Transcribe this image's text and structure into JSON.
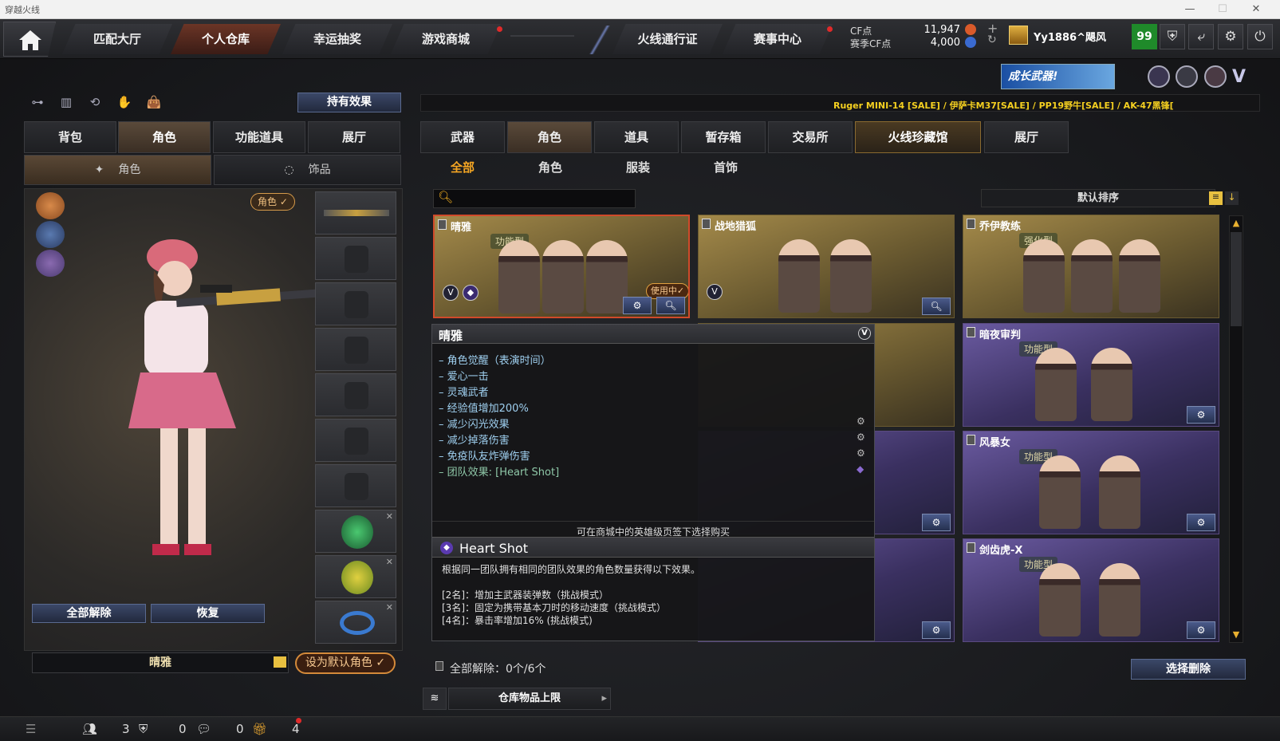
{
  "window": {
    "title": "穿越火线"
  },
  "topnav": {
    "tabs": [
      {
        "label": "匹配大厅"
      },
      {
        "label": "个人仓库",
        "active": true
      },
      {
        "label": "幸运抽奖"
      },
      {
        "label": "游戏商城"
      },
      {
        "label": "火线通行证"
      },
      {
        "label": "赛事中心"
      }
    ],
    "cf_label": "CF点",
    "season_cf_label": "赛季CF点",
    "cf_value": "11,947",
    "season_cf_value": "4,000",
    "username": "Yy1886^飓风",
    "level": "99"
  },
  "promo": {
    "label": "成长武器!"
  },
  "ticker": {
    "text": "Ruger MINI-14  [SALE] / 伊萨卡M37[SALE] / PP19野牛[SALE] / AK-47黑锋["
  },
  "left": {
    "hold_effect_button": "持有效果",
    "tabs": [
      "背包",
      "角色",
      "功能道具",
      "展厅"
    ],
    "subtabs": [
      "角色",
      "饰品"
    ],
    "role_badge": "角色",
    "unequip_all": "全部解除",
    "restore": "恢复",
    "character_name": "晴雅",
    "set_default": "设为默认角色"
  },
  "right": {
    "tabs": [
      "武器",
      "角色",
      "道具",
      "暂存箱",
      "交易所",
      "火线珍藏馆",
      "展厅"
    ],
    "subtabs": [
      "全部",
      "角色",
      "服装",
      "首饰"
    ],
    "search_placeholder": "",
    "sort_label": "默认排序",
    "cards": [
      {
        "name": "晴雅",
        "type": "功能型",
        "in_use": "使用中"
      },
      {
        "name": "战地猎狐",
        "type": ""
      },
      {
        "name": "乔伊教练",
        "type": "强化型"
      },
      {
        "name": "暗夜审判",
        "type": "功能型"
      },
      {
        "name": "风暴女",
        "type": "功能型"
      },
      {
        "name": "剑齿虎-X",
        "type": "功能型"
      }
    ],
    "unequip_count": "全部解除：0个/6个",
    "select_delete": "选择删除",
    "storage_limit": "仓库物品上限"
  },
  "tooltip": {
    "title": "晴雅",
    "lines": [
      "– 角色觉醒（表演时间）",
      "– 爱心一击",
      "– 灵魂武者",
      "– 经验值增加200%",
      "– 减少闪光效果",
      "– 减少掉落伤害",
      "– 免疫队友炸弹伤害",
      "– 团队效果: [Heart Shot]"
    ],
    "note": "可在商城中的英雄级页签下选择购买",
    "effect_title": "Heart Shot",
    "effect_desc": "根据同一团队拥有相同的团队效果的角色数量获得以下效果。",
    "effect_lines": [
      "[2名]：增加主武器装弹数（挑战模式）",
      "[3名]：固定为携带基本刀时的移动速度（挑战模式）",
      "[4名]：暴击率增加16% (挑战模式)"
    ]
  },
  "statusbar": {
    "count1": "3",
    "count2": "0",
    "count3": "0",
    "count4": "4"
  }
}
